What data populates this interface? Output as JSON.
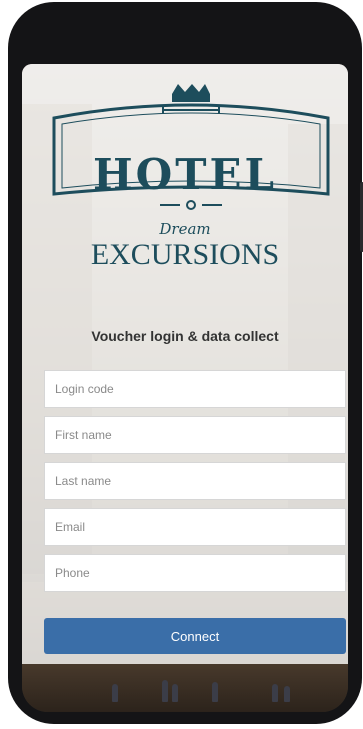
{
  "brand": {
    "line1": "HOTEL",
    "line2": "Dream",
    "line3": "EXCURSIONS",
    "crown_icon": "crown-icon",
    "color": "#1d4d5c"
  },
  "form": {
    "title": "Voucher login & data collect",
    "fields": [
      {
        "placeholder": "Login code",
        "value": ""
      },
      {
        "placeholder": "First name",
        "value": ""
      },
      {
        "placeholder": "Last name",
        "value": ""
      },
      {
        "placeholder": "Email",
        "value": ""
      },
      {
        "placeholder": "Phone",
        "value": ""
      }
    ],
    "connect_label": "Connect",
    "button_color": "#3a6ea8"
  }
}
